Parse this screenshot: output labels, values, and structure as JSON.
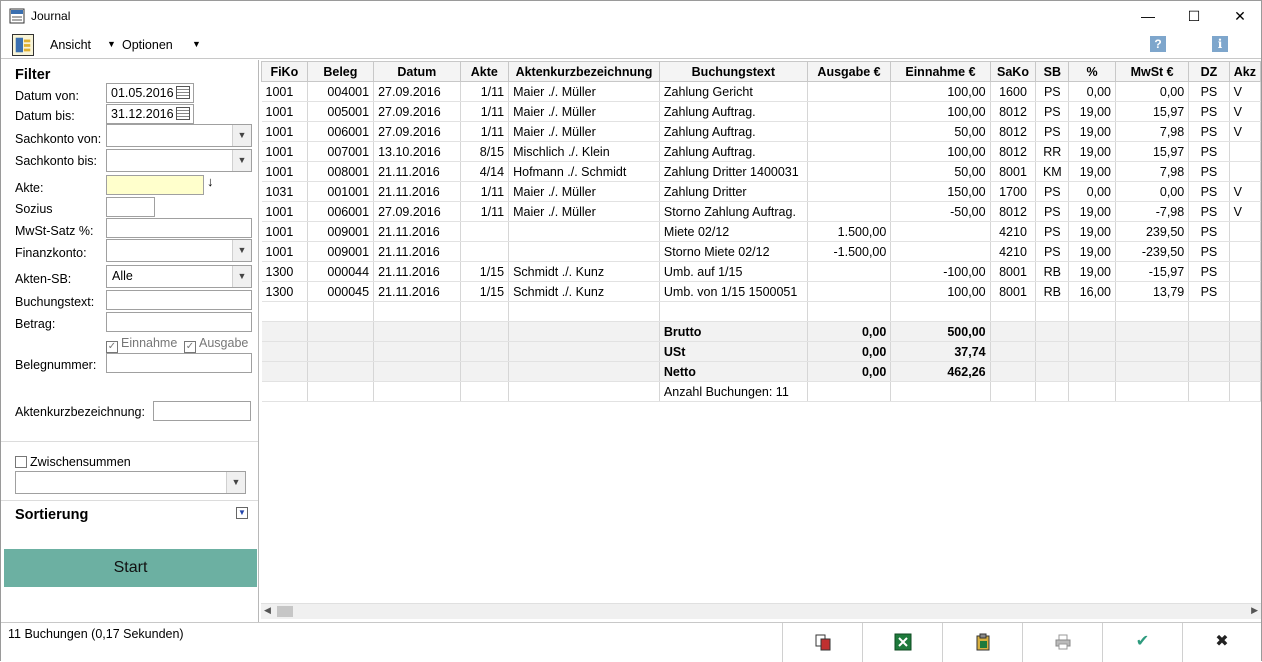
{
  "window": {
    "title": "Journal",
    "minimize": "—",
    "maximize": "☐",
    "close": "✕"
  },
  "menu": {
    "ansicht": "Ansicht",
    "optionen": "Optionen",
    "help_icon": "?",
    "info_icon": "i"
  },
  "filter": {
    "heading": "Filter",
    "datum_von_label": "Datum von:",
    "datum_von": "01.05.2016",
    "datum_bis_label": "Datum bis:",
    "datum_bis": "31.12.2016",
    "sachkonto_von_label": "Sachkonto von:",
    "sachkonto_von": "",
    "sachkonto_bis_label": "Sachkonto bis:",
    "sachkonto_bis": "",
    "akte_label": "Akte:",
    "akte": "",
    "sozius_label": "Sozius",
    "sozius": "",
    "mwst_label": "MwSt-Satz %:",
    "mwst": "",
    "finanzkonto_label": "Finanzkonto:",
    "finanzkonto": "",
    "akten_sb_label": "Akten-SB:",
    "akten_sb": "Alle",
    "buchungstext_label": "Buchungstext:",
    "buchungstext": "",
    "betrag_label": "Betrag:",
    "betrag": "",
    "einnahme_label": "Einnahme",
    "ausgabe_label": "Ausgabe",
    "belegnummer_label": "Belegnummer:",
    "belegnummer": "",
    "aktenkurz_label": "Aktenkurzbezeichnung:",
    "aktenkurz": "",
    "zwischensummen_label": "Zwischensummen",
    "zwischensummen_select": "",
    "sortierung_heading": "Sortierung",
    "start_label": "Start"
  },
  "grid": {
    "columns": [
      "FiKo",
      "Beleg",
      "Datum",
      "Akte",
      "Aktenkurzbezeichnung",
      "Buchungstext",
      "Ausgabe €",
      "Einnahme €",
      "SaKo",
      "SB",
      "%",
      "MwSt €",
      "DZ",
      "Akz"
    ],
    "rows": [
      [
        "1001",
        "004001",
        "27.09.2016",
        "1/11",
        "Maier ./. Müller",
        "Zahlung Gericht",
        "",
        "100,00",
        "1600",
        "PS",
        "0,00",
        "0,00",
        "PS",
        "V"
      ],
      [
        "1001",
        "005001",
        "27.09.2016",
        "1/11",
        "Maier ./. Müller",
        "Zahlung Auftrag.",
        "",
        "100,00",
        "8012",
        "PS",
        "19,00",
        "15,97",
        "PS",
        "V"
      ],
      [
        "1001",
        "006001",
        "27.09.2016",
        "1/11",
        "Maier ./. Müller",
        "Zahlung Auftrag.",
        "",
        "50,00",
        "8012",
        "PS",
        "19,00",
        "7,98",
        "PS",
        "V"
      ],
      [
        "1001",
        "007001",
        "13.10.2016",
        "8/15",
        "Mischlich ./. Klein",
        "Zahlung Auftrag.",
        "",
        "100,00",
        "8012",
        "RR",
        "19,00",
        "15,97",
        "PS",
        ""
      ],
      [
        "1001",
        "008001",
        "21.11.2016",
        "4/14",
        "Hofmann ./. Schmidt",
        "Zahlung Dritter 1400031",
        "",
        "50,00",
        "8001",
        "KM",
        "19,00",
        "7,98",
        "PS",
        ""
      ],
      [
        "1031",
        "001001",
        "21.11.2016",
        "1/11",
        "Maier ./. Müller",
        "Zahlung Dritter",
        "",
        "150,00",
        "1700",
        "PS",
        "0,00",
        "0,00",
        "PS",
        "V"
      ],
      [
        "1001",
        "006001",
        "27.09.2016",
        "1/11",
        "Maier ./. Müller",
        "Storno Zahlung Auftrag.",
        "",
        "-50,00",
        "8012",
        "PS",
        "19,00",
        "-7,98",
        "PS",
        "V"
      ],
      [
        "1001",
        "009001",
        "21.11.2016",
        "",
        "",
        "Miete 02/12",
        "1.500,00",
        "",
        "4210",
        "PS",
        "19,00",
        "239,50",
        "PS",
        ""
      ],
      [
        "1001",
        "009001",
        "21.11.2016",
        "",
        "",
        "Storno Miete 02/12",
        "-1.500,00",
        "",
        "4210",
        "PS",
        "19,00",
        "-239,50",
        "PS",
        ""
      ],
      [
        "1300",
        "000044",
        "21.11.2016",
        "1/15",
        "Schmidt ./. Kunz",
        "Umb. auf 1/15",
        "",
        "-100,00",
        "8001",
        "RB",
        "19,00",
        "-15,97",
        "PS",
        ""
      ],
      [
        "1300",
        "000045",
        "21.11.2016",
        "1/15",
        "Schmidt ./. Kunz",
        "Umb. von 1/15 1500051",
        "",
        "100,00",
        "8001",
        "RB",
        "16,00",
        "13,79",
        "PS",
        ""
      ]
    ],
    "summary": [
      {
        "label": "Brutto",
        "ausgabe": "0,00",
        "einnahme": "500,00"
      },
      {
        "label": "USt",
        "ausgabe": "0,00",
        "einnahme": "37,74"
      },
      {
        "label": "Netto",
        "ausgabe": "0,00",
        "einnahme": "462,26"
      }
    ],
    "count_label": "Anzahl Buchungen: 11"
  },
  "status": {
    "text": "11 Buchungen (0,17 Sekunden)"
  },
  "bottom_icons": [
    "copy-icon",
    "excel-icon",
    "clipboard-icon",
    "print-icon",
    "ok-check-icon",
    "close-x-icon"
  ],
  "colors": {
    "start_button": "#6cb0a2",
    "akte_field": "#ffffcc",
    "ok_check": "#2e9b7e"
  }
}
